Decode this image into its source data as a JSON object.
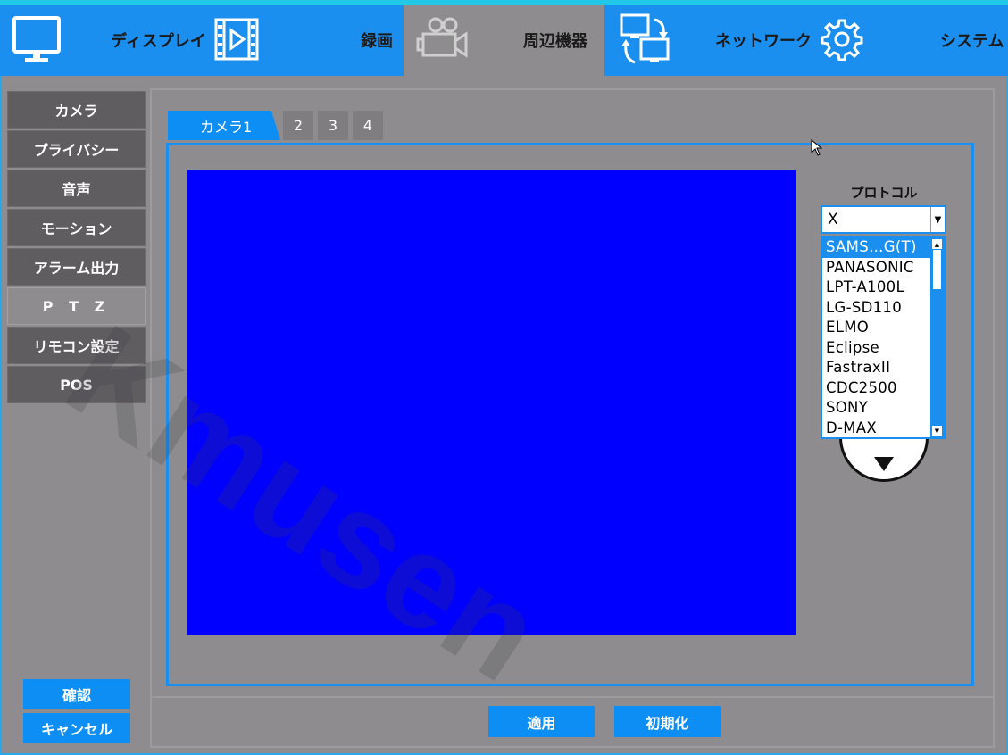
{
  "topnav": {
    "items": [
      {
        "label": "ディスプレイ",
        "icon": "monitor-icon"
      },
      {
        "label": "録画",
        "icon": "film-play-icon"
      },
      {
        "label": "周辺機器",
        "icon": "camera-icon"
      },
      {
        "label": "ネットワーク",
        "icon": "network-monitors-icon"
      },
      {
        "label": "システム",
        "icon": "gear-icon"
      }
    ]
  },
  "sidebar": {
    "items": [
      {
        "label": "カメラ"
      },
      {
        "label": "プライバシー"
      },
      {
        "label": "音声"
      },
      {
        "label": "モーション"
      },
      {
        "label": "アラーム出力"
      },
      {
        "label": "P T Z"
      },
      {
        "label": "リモコン設定"
      },
      {
        "label": "POS"
      }
    ],
    "confirm_label": "確認",
    "cancel_label": "キャンセル"
  },
  "tabs": [
    "カメラ1",
    "2",
    "3",
    "4"
  ],
  "protocol": {
    "label": "プロトコル",
    "selected_value": "X",
    "options": [
      "SAMS…G(T)",
      "PANASONIC",
      "LPT-A100L",
      "LG-SD110",
      "ELMO",
      "Eclipse",
      "FastraxII",
      "CDC2500",
      "SONY",
      "D-MAX"
    ]
  },
  "buttons": {
    "apply_label": "適用",
    "reset_label": "初期化"
  },
  "watermark": "Kmusen",
  "colors": {
    "accent": "#1a8ff0",
    "video_background": "#0000ff",
    "panel_background": "#8e8c8e"
  }
}
